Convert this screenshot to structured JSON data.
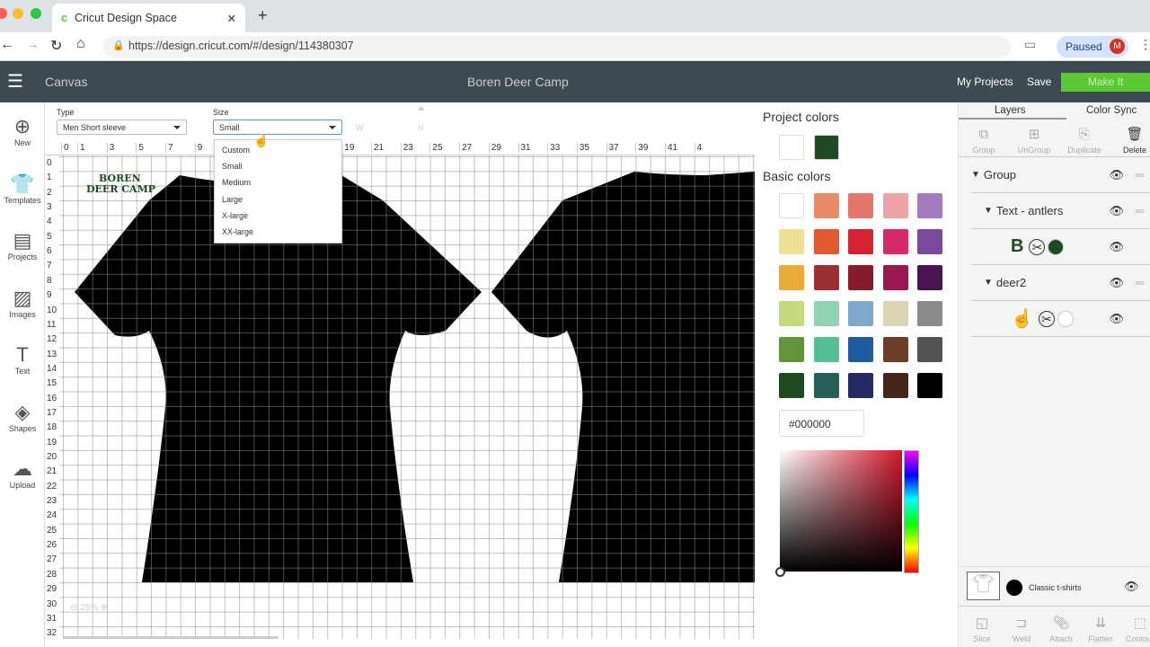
{
  "browser": {
    "tab_title": "Cricut Design Space",
    "url": "https://design.cricut.com/#/design/114380307",
    "paused_label": "Paused",
    "avatar_letter": "M"
  },
  "app": {
    "section": "Canvas",
    "project_title": "Boren Deer Camp",
    "my_projects": "My Projects",
    "save": "Save",
    "make_it": "Make It",
    "accent": "#5cc932"
  },
  "left_nav": [
    {
      "label": "New",
      "icon": "plus-circle-icon",
      "glyph": "⊕"
    },
    {
      "label": "Templates",
      "icon": "tshirt-icon",
      "glyph": "👕"
    },
    {
      "label": "Projects",
      "icon": "projects-icon",
      "glyph": "▤"
    },
    {
      "label": "Images",
      "icon": "images-icon",
      "glyph": "▨"
    },
    {
      "label": "Text",
      "icon": "text-icon",
      "glyph": "T"
    },
    {
      "label": "Shapes",
      "icon": "shapes-icon",
      "glyph": "◈"
    },
    {
      "label": "Upload",
      "icon": "upload-icon",
      "glyph": "☁"
    }
  ],
  "props": {
    "type_label": "Type",
    "type_value": "Men Short sleeve",
    "size_label": "Size",
    "size_value": "Small",
    "w_label": "W",
    "h_label": "H"
  },
  "size_options": [
    "Custom",
    "Small",
    "Medium",
    "Large",
    "X-large",
    "XX-large"
  ],
  "ruler": {
    "top": [
      "0",
      "1",
      "3",
      "5",
      "7",
      "9",
      "11",
      "13",
      "15",
      "17",
      "19",
      "21",
      "23",
      "25",
      "27",
      "29",
      "31",
      "33",
      "35",
      "37",
      "39",
      "41",
      "4"
    ],
    "left": [
      "0",
      "1",
      "2",
      "3",
      "4",
      "5",
      "6",
      "7",
      "8",
      "9",
      "10",
      "11",
      "12",
      "13",
      "14",
      "15",
      "16",
      "17",
      "18",
      "19",
      "20",
      "21",
      "22",
      "23",
      "24",
      "25",
      "26",
      "27",
      "28",
      "29",
      "30",
      "31",
      "32"
    ]
  },
  "canvas": {
    "design_text_1": "BOREN",
    "design_text_2": "DEER CAMP",
    "zoom": "25%"
  },
  "colors": {
    "project_title": "Project colors",
    "project": [
      "#ffffff",
      "#1f4a1f"
    ],
    "basic_title": "Basic colors",
    "basic": [
      "#ffffff",
      "#e98a6b",
      "#e4776a",
      "#eba5a7",
      "#a47bbd",
      "#efe193",
      "#df5a30",
      "#d42330",
      "#d62a6b",
      "#7a4a9c",
      "#e8ac35",
      "#9c2e33",
      "#851c2c",
      "#98184f",
      "#4a1251",
      "#c5da7c",
      "#90d3b3",
      "#7fa9cc",
      "#dcd3b3",
      "#8b8b8b",
      "#64943a",
      "#55bd94",
      "#1f5da3",
      "#6a3f26",
      "#535353",
      "#1f4a1f",
      "#2a5e58",
      "#262c63",
      "#46251b",
      "#000000"
    ],
    "hex_value": "#000000"
  },
  "layers": {
    "tab_layers": "Layers",
    "tab_colorsync": "Color Sync",
    "tools": [
      "Group",
      "UnGroup",
      "Duplicate",
      "Delete"
    ],
    "rows": [
      {
        "label": "Group"
      },
      {
        "label": "Text - antlers"
      },
      {
        "label": ""
      },
      {
        "label": "deer2"
      },
      {
        "label": ""
      }
    ],
    "canvas_label": "Classic t-shirts",
    "bottom_tools": [
      "Slice",
      "Weld",
      "Attach",
      "Flatten",
      "Contour"
    ]
  }
}
